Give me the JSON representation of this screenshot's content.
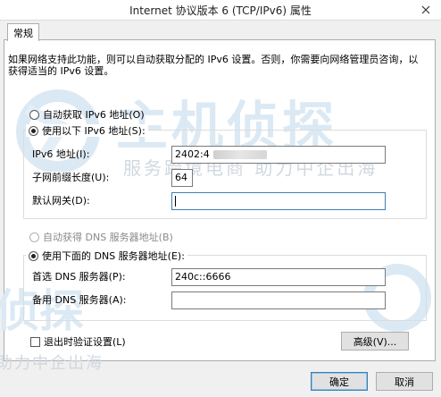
{
  "window": {
    "title": "Internet 协议版本 6 (TCP/IPv6) 属性"
  },
  "tabs": [
    {
      "label": "常规"
    }
  ],
  "description": "如果网络支持此功能，则可以自动获取分配的 IPv6 设置。否则，你需要向网络管理员咨询，以获得适当的 IPv6 设置。",
  "ip_section": {
    "auto_label": "自动获取 IPv6 地址(O)",
    "manual_label": "使用以下 IPv6 地址(S):",
    "auto_selected": false,
    "manual_selected": true,
    "fields": {
      "ipv6_label": "IPv6 地址(I):",
      "ipv6_value": "2402:4",
      "prefix_label": "子网前缀长度(U):",
      "prefix_value": "64",
      "gateway_label": "默认网关(D):",
      "gateway_value": ""
    }
  },
  "dns_section": {
    "auto_label": "自动获得 DNS 服务器地址(B)",
    "manual_label": "使用下面的 DNS 服务器地址(E):",
    "preferred_label": "首选 DNS 服务器(P):",
    "preferred_value": "240c::6666",
    "alternate_label": "备用 DNS 服务器(A):",
    "alternate_value": ""
  },
  "validate_on_exit_label": "退出时验证设置(L)",
  "validate_on_exit_checked": false,
  "advanced_button": "高级(V)...",
  "ok_button": "确定",
  "cancel_button": "取消",
  "watermark": {
    "brand_large": "主机侦探",
    "brand_slogan": "服务跨境电商 助力中企出海",
    "brand_partial": "侦探",
    "slogan_partial": "助力中企出海"
  },
  "colors": {
    "accent": "#3c7fb1",
    "watermark": "#dbe9f4"
  },
  "icons": {
    "close": "close-icon"
  }
}
